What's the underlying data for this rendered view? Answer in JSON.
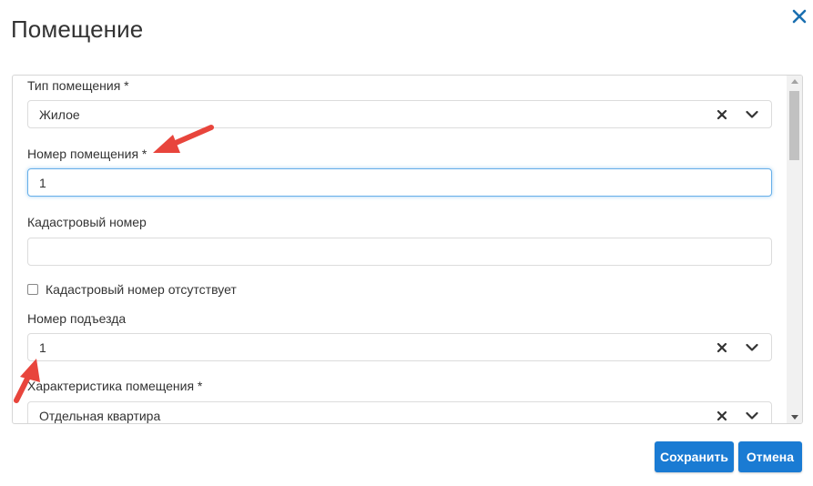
{
  "dialog": {
    "title": "Помещение"
  },
  "form": {
    "room_type": {
      "label": "Тип помещения *",
      "value": "Жилое"
    },
    "room_number": {
      "label": "Номер помещения *",
      "value": "1"
    },
    "cadastral_number": {
      "label": "Кадастровый номер",
      "value": ""
    },
    "cadastral_missing": {
      "label": "Кадастровый номер отсутствует",
      "checked": false
    },
    "entrance_number": {
      "label": "Номер подъезда",
      "value": "1"
    },
    "room_characteristic": {
      "label": "Характеристика помещения *",
      "value": "Отдельная квартира"
    }
  },
  "buttons": {
    "save": "Сохранить",
    "cancel": "Отмена"
  },
  "colors": {
    "primary": "#1a7bd3",
    "close_icon": "#1a6fb0",
    "annotation_arrow": "#e8453c"
  },
  "icons": {
    "close": "close-icon",
    "clear": "clear-x-icon",
    "dropdown": "chevron-down-icon"
  }
}
